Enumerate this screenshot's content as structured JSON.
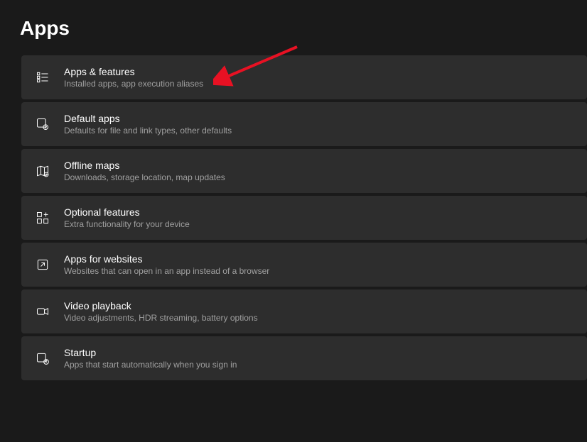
{
  "pageTitle": "Apps",
  "items": [
    {
      "id": "apps-features",
      "title": "Apps & features",
      "desc": "Installed apps, app execution aliases"
    },
    {
      "id": "default-apps",
      "title": "Default apps",
      "desc": "Defaults for file and link types, other defaults"
    },
    {
      "id": "offline-maps",
      "title": "Offline maps",
      "desc": "Downloads, storage location, map updates"
    },
    {
      "id": "optional-features",
      "title": "Optional features",
      "desc": "Extra functionality for your device"
    },
    {
      "id": "apps-for-websites",
      "title": "Apps for websites",
      "desc": "Websites that can open in an app instead of a browser"
    },
    {
      "id": "video-playback",
      "title": "Video playback",
      "desc": "Video adjustments, HDR streaming, battery options"
    },
    {
      "id": "startup",
      "title": "Startup",
      "desc": "Apps that start automatically when you sign in"
    }
  ]
}
